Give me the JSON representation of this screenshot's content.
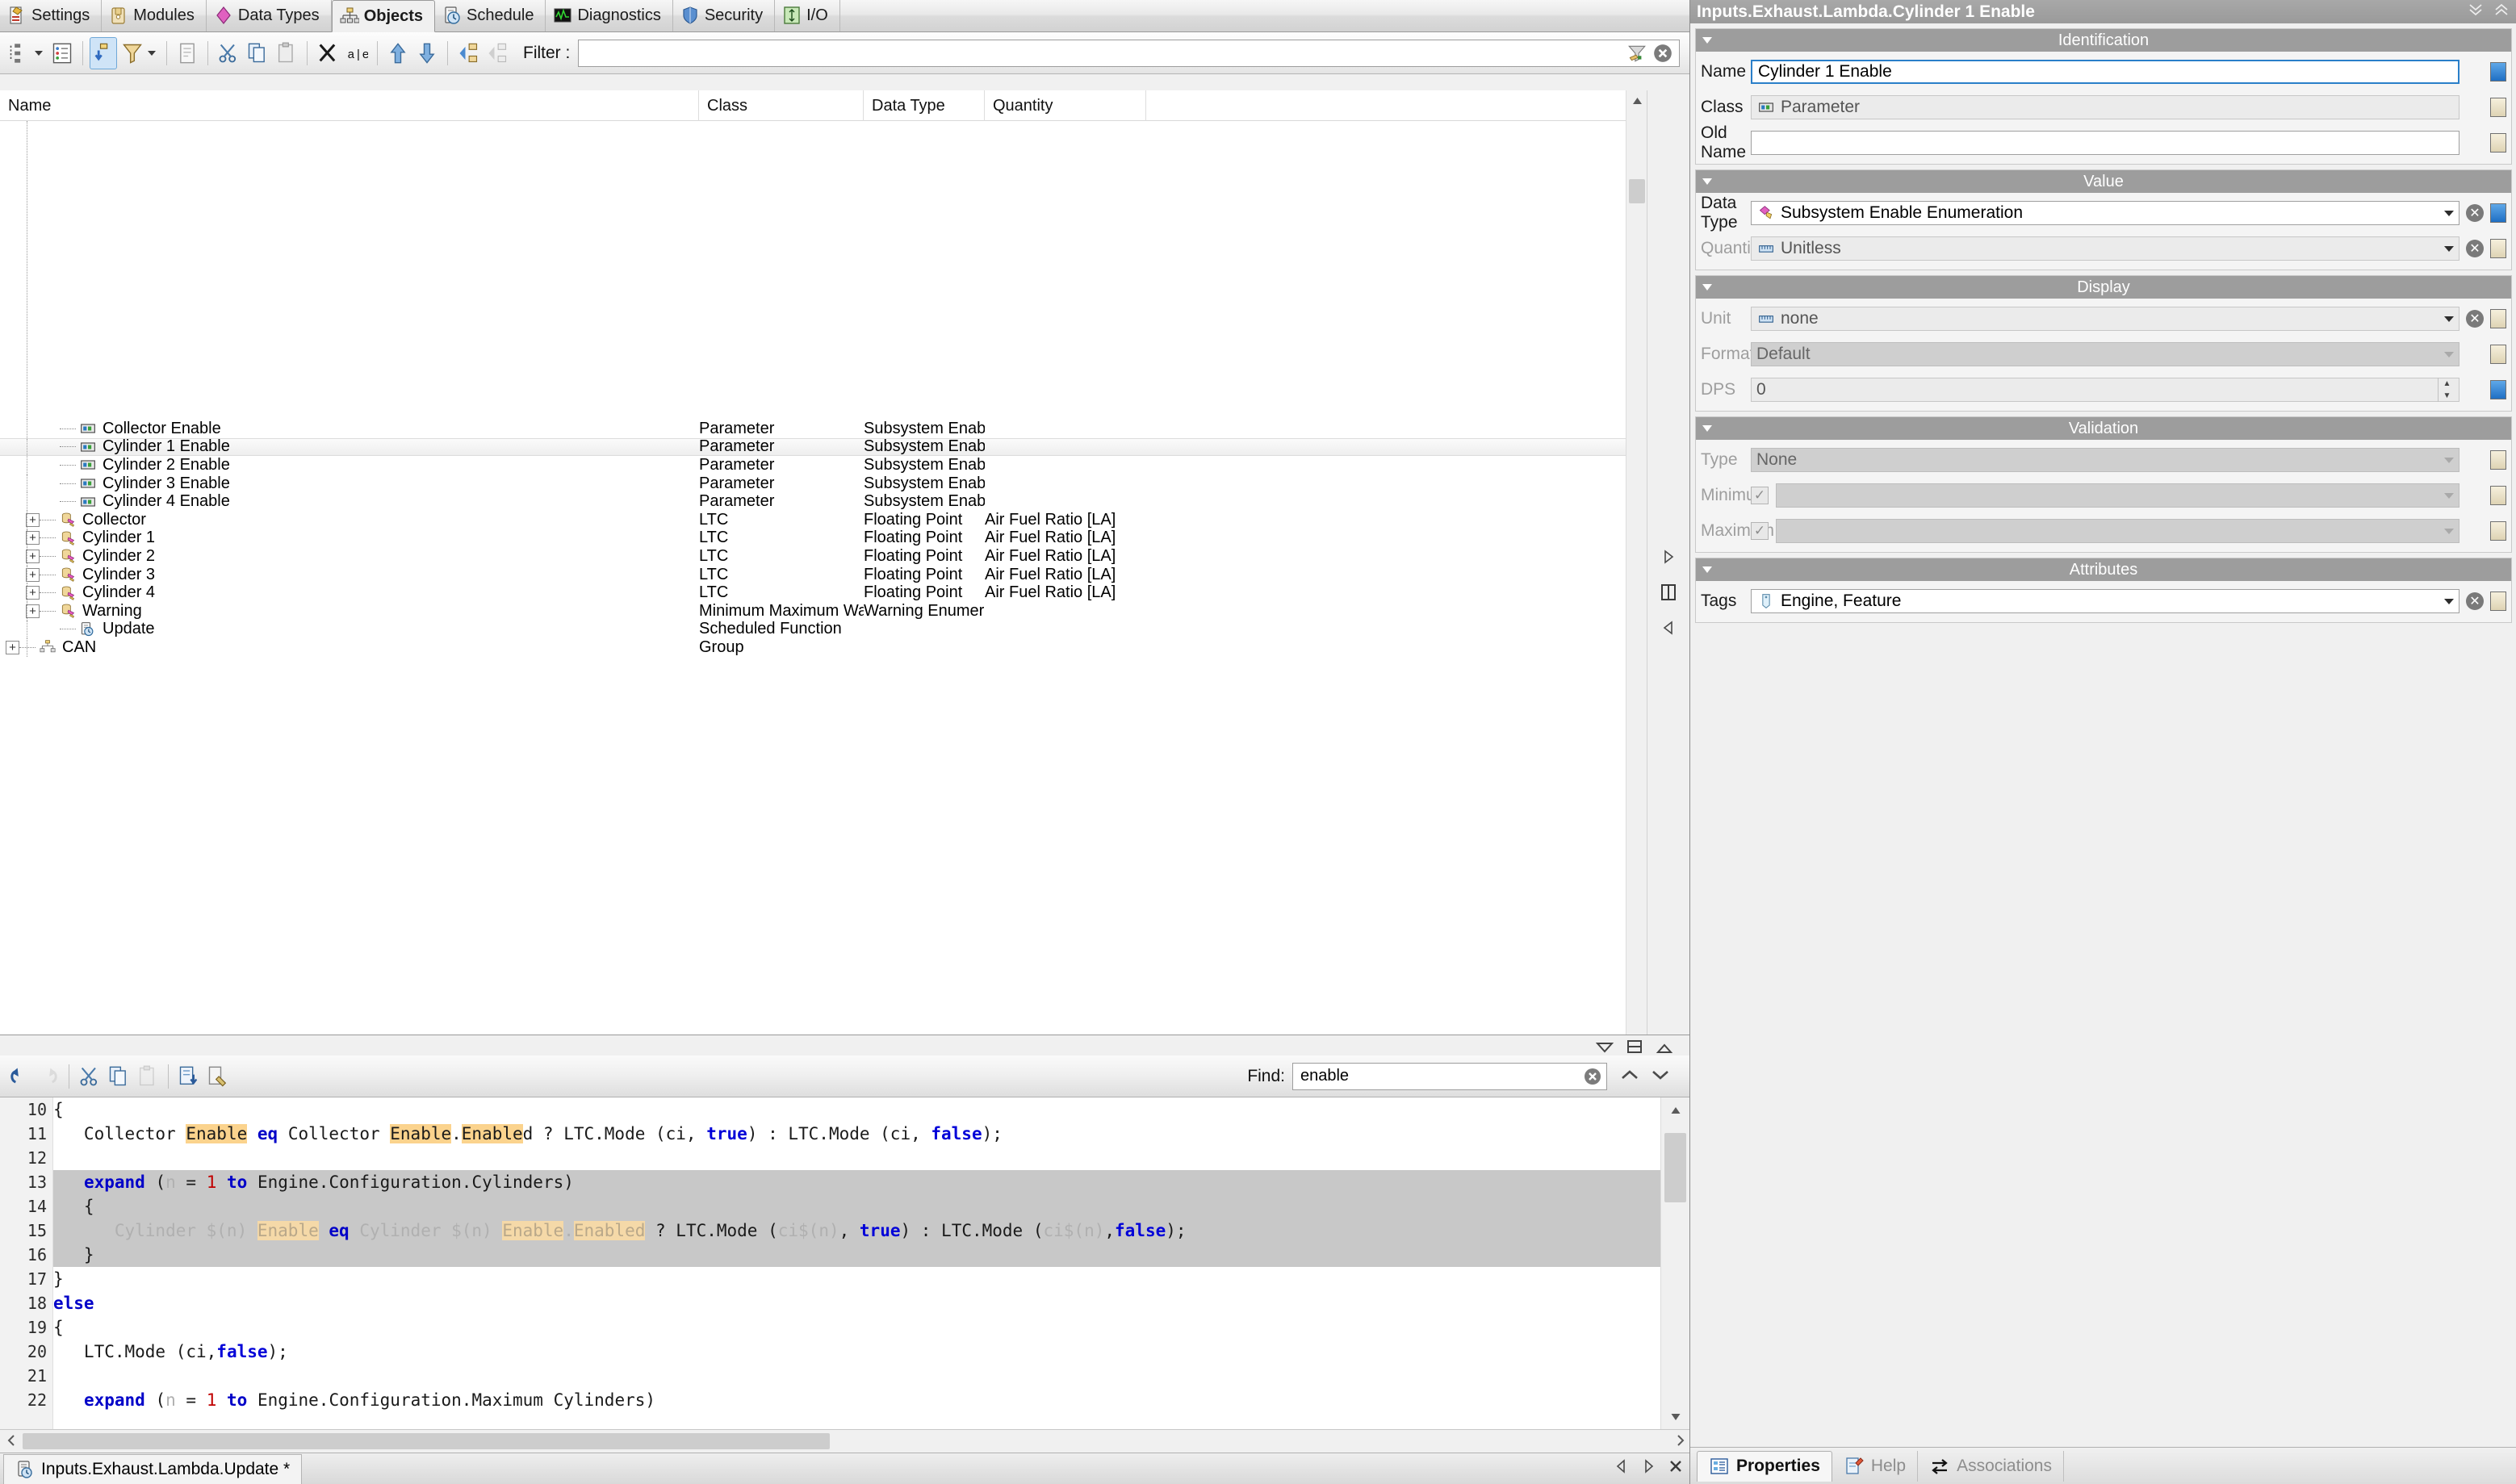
{
  "main_tabs": [
    {
      "label": "Settings",
      "icon": "settings-icon",
      "active": false
    },
    {
      "label": "Modules",
      "icon": "modules-icon",
      "active": false
    },
    {
      "label": "Data Types",
      "icon": "data-types-icon",
      "active": false
    },
    {
      "label": "Objects",
      "icon": "objects-icon",
      "active": true
    },
    {
      "label": "Schedule",
      "icon": "schedule-icon",
      "active": false
    },
    {
      "label": "Diagnostics",
      "icon": "diagnostics-icon",
      "active": false
    },
    {
      "label": "Security",
      "icon": "security-icon",
      "active": false
    },
    {
      "label": "I/O",
      "icon": "io-icon",
      "active": false
    }
  ],
  "object_toolbar": {
    "buttons": [
      {
        "name": "tree-view-button",
        "icon": "tree-icon",
        "pressed": false,
        "has_caret": true
      },
      {
        "name": "list-view-button",
        "icon": "list-icon",
        "pressed": false,
        "has_caret": false
      },
      {
        "name": "sync-selection-button",
        "icon": "sync-icon",
        "pressed": true,
        "has_caret": false
      },
      {
        "name": "filter-button",
        "icon": "funnel-icon",
        "pressed": false,
        "has_caret": true
      },
      {
        "name": "properties-button",
        "icon": "document-icon",
        "pressed": false,
        "has_caret": false
      },
      {
        "name": "cut-button",
        "icon": "scissors-icon",
        "pressed": false,
        "has_caret": false
      },
      {
        "name": "copy-button",
        "icon": "copy-icon",
        "pressed": false,
        "has_caret": false
      },
      {
        "name": "paste-button",
        "icon": "paste-icon",
        "pressed": false,
        "has_caret": false
      },
      {
        "name": "delete-button",
        "icon": "x-icon",
        "pressed": false,
        "has_caret": false
      },
      {
        "name": "rename-button",
        "icon": "rename-icon",
        "pressed": false,
        "has_caret": false
      },
      {
        "name": "move-up-button",
        "icon": "arrow-up-icon",
        "pressed": false,
        "has_caret": false
      },
      {
        "name": "move-down-button",
        "icon": "arrow-down-icon",
        "pressed": false,
        "has_caret": false
      },
      {
        "name": "expand-all-button",
        "icon": "expand-all-icon",
        "pressed": false,
        "has_caret": false
      },
      {
        "name": "collapse-all-button",
        "icon": "collapse-all-icon",
        "pressed": false,
        "has_caret": false
      }
    ],
    "filter_label": "Filter :",
    "filter_value": "",
    "filter_placeholder": "",
    "apply_filter_icon": "funnel-apply-icon",
    "clear_filter_icon": "clear-circle-icon"
  },
  "tree": {
    "columns": [
      "Name",
      "Class",
      "Data Type",
      "Quantity"
    ],
    "rows": [
      {
        "name": "Collector Enable",
        "indent": 2,
        "expander": "",
        "icon": "parameter-icon",
        "class": "Parameter",
        "dtype": "Subsystem Enable ...",
        "qty": "",
        "selected": false
      },
      {
        "name": "Cylinder 1 Enable",
        "indent": 2,
        "expander": "",
        "icon": "parameter-icon",
        "class": "Parameter",
        "dtype": "Subsystem Enable ...",
        "qty": "",
        "selected": true
      },
      {
        "name": "Cylinder 2 Enable",
        "indent": 2,
        "expander": "",
        "icon": "parameter-icon",
        "class": "Parameter",
        "dtype": "Subsystem Enable ...",
        "qty": "",
        "selected": false
      },
      {
        "name": "Cylinder 3 Enable",
        "indent": 2,
        "expander": "",
        "icon": "parameter-icon",
        "class": "Parameter",
        "dtype": "Subsystem Enable ...",
        "qty": "",
        "selected": false
      },
      {
        "name": "Cylinder 4 Enable",
        "indent": 2,
        "expander": "",
        "icon": "parameter-icon",
        "class": "Parameter",
        "dtype": "Subsystem Enable ...",
        "qty": "",
        "selected": false
      },
      {
        "name": "Collector",
        "indent": 1,
        "expander": "+",
        "icon": "ltc-icon",
        "class": "LTC",
        "dtype": "Floating Point",
        "qty": "Air Fuel Ratio [LA]",
        "selected": false
      },
      {
        "name": "Cylinder 1",
        "indent": 1,
        "expander": "+",
        "icon": "ltc-icon",
        "class": "LTC",
        "dtype": "Floating Point",
        "qty": "Air Fuel Ratio [LA]",
        "selected": false
      },
      {
        "name": "Cylinder 2",
        "indent": 1,
        "expander": "+",
        "icon": "ltc-icon",
        "class": "LTC",
        "dtype": "Floating Point",
        "qty": "Air Fuel Ratio [LA]",
        "selected": false
      },
      {
        "name": "Cylinder 3",
        "indent": 1,
        "expander": "+",
        "icon": "ltc-icon",
        "class": "LTC",
        "dtype": "Floating Point",
        "qty": "Air Fuel Ratio [LA]",
        "selected": false
      },
      {
        "name": "Cylinder 4",
        "indent": 1,
        "expander": "+",
        "icon": "ltc-icon",
        "class": "LTC",
        "dtype": "Floating Point",
        "qty": "Air Fuel Ratio [LA]",
        "selected": false
      },
      {
        "name": "Warning",
        "indent": 1,
        "expander": "+",
        "icon": "ltc-icon",
        "class": "Minimum Maximum Warning",
        "dtype": "Warning Enumeration",
        "qty": "",
        "selected": false
      },
      {
        "name": "Update",
        "indent": 2,
        "expander": "",
        "icon": "function-icon",
        "class": "Scheduled Function",
        "dtype": "",
        "qty": "",
        "selected": false
      },
      {
        "name": "CAN",
        "indent": 0,
        "expander": "+",
        "icon": "group-icon",
        "class": "Group",
        "dtype": "",
        "qty": "",
        "selected": false
      }
    ]
  },
  "editor_strip": {
    "icons": [
      "filter-down-icon",
      "split-horizontal-icon",
      "collapse-up-icon"
    ]
  },
  "code_toolbar": {
    "buttons": [
      {
        "name": "undo-button",
        "icon": "undo-icon",
        "disabled": false
      },
      {
        "name": "redo-button",
        "icon": "redo-icon",
        "disabled": true
      },
      {
        "name": "cut-button",
        "icon": "scissors-icon",
        "disabled": false
      },
      {
        "name": "copy-button",
        "icon": "copy-icon",
        "disabled": false
      },
      {
        "name": "paste-button",
        "icon": "paste-icon",
        "disabled": true
      },
      {
        "name": "insert-snippet-button",
        "icon": "insert-doc-icon",
        "disabled": false
      },
      {
        "name": "build-button",
        "icon": "build-doc-icon",
        "disabled": false
      }
    ],
    "find_label": "Find:",
    "find_value": "enable",
    "find_placeholder": "",
    "clear_find_icon": "clear-circle-icon",
    "find_prev_icon": "chevron-up-icon",
    "find_next_icon": "chevron-down-icon"
  },
  "code": {
    "first_line": 10,
    "lines": [
      {
        "n": 10,
        "selected": false,
        "tokens": [
          {
            "t": "{"
          }
        ]
      },
      {
        "n": 11,
        "selected": false,
        "tokens": [
          {
            "t": "   Collector "
          },
          {
            "t": "Enable",
            "s": "hl"
          },
          {
            "t": " "
          },
          {
            "t": "eq",
            "s": "kw"
          },
          {
            "t": " Collector "
          },
          {
            "t": "Enable",
            "s": "hl"
          },
          {
            "t": "."
          },
          {
            "t": "Enable",
            "s": "hl"
          },
          {
            "t": "d ? LTC.Mode (ci, "
          },
          {
            "t": "true",
            "s": "lit"
          },
          {
            "t": ") : LTC.Mode (ci, "
          },
          {
            "t": "false",
            "s": "lit"
          },
          {
            "t": ");"
          }
        ]
      },
      {
        "n": 12,
        "selected": false,
        "tokens": [
          {
            "t": ""
          }
        ]
      },
      {
        "n": 13,
        "selected": true,
        "tokens": [
          {
            "t": "   "
          },
          {
            "t": "expand",
            "s": "kw"
          },
          {
            "t": " ("
          },
          {
            "t": "n",
            "s": "dim"
          },
          {
            "t": " = "
          },
          {
            "t": "1",
            "s": "num"
          },
          {
            "t": " "
          },
          {
            "t": "to",
            "s": "kw"
          },
          {
            "t": " Engine.Configuration.Cylinders)"
          }
        ]
      },
      {
        "n": 14,
        "selected": true,
        "tokens": [
          {
            "t": "   {"
          }
        ]
      },
      {
        "n": 15,
        "selected": true,
        "tokens": [
          {
            "t": "      Cylinder $(n) ",
            "s": "dim"
          },
          {
            "t": "Enable",
            "s": "dimhl"
          },
          {
            "t": " ",
            "s": "dim"
          },
          {
            "t": "eq",
            "s": "kw"
          },
          {
            "t": " Cylinder $(n) ",
            "s": "dim"
          },
          {
            "t": "Enable",
            "s": "dimhl"
          },
          {
            "t": ".",
            "s": "dim"
          },
          {
            "t": "Enabled",
            "s": "dimhl"
          },
          {
            "t": " ? LTC.Mode ("
          },
          {
            "t": "ci$(n)",
            "s": "dim"
          },
          {
            "t": ", "
          },
          {
            "t": "true",
            "s": "lit"
          },
          {
            "t": ") : LTC.Mode ("
          },
          {
            "t": "ci$(n)",
            "s": "dim"
          },
          {
            "t": ","
          },
          {
            "t": "false",
            "s": "lit"
          },
          {
            "t": ");"
          }
        ]
      },
      {
        "n": 16,
        "selected": true,
        "tokens": [
          {
            "t": "   }"
          }
        ]
      },
      {
        "n": 17,
        "selected": false,
        "tokens": [
          {
            "t": "}"
          }
        ]
      },
      {
        "n": 18,
        "selected": false,
        "tokens": [
          {
            "t": "else",
            "s": "kw"
          }
        ]
      },
      {
        "n": 19,
        "selected": false,
        "tokens": [
          {
            "t": "{"
          }
        ]
      },
      {
        "n": 20,
        "selected": false,
        "tokens": [
          {
            "t": "   LTC.Mode (ci,"
          },
          {
            "t": "false",
            "s": "lit"
          },
          {
            "t": ");"
          }
        ]
      },
      {
        "n": 21,
        "selected": false,
        "tokens": [
          {
            "t": ""
          }
        ]
      },
      {
        "n": 22,
        "selected": false,
        "tokens": [
          {
            "t": "   "
          },
          {
            "t": "expand",
            "s": "kw"
          },
          {
            "t": " ("
          },
          {
            "t": "n",
            "s": "dim"
          },
          {
            "t": " = "
          },
          {
            "t": "1",
            "s": "num"
          },
          {
            "t": " "
          },
          {
            "t": "to",
            "s": "kw"
          },
          {
            "t": " Engine.Configuration.Maximum Cylinders)"
          }
        ]
      }
    ]
  },
  "doc_tabs": {
    "tabs": [
      {
        "label": "Inputs.Exhaust.Lambda.Update *",
        "icon": "function-icon",
        "active": true
      }
    ],
    "nav_prev_icon": "nav-prev-icon",
    "nav_next_icon": "nav-next-icon",
    "close_icon": "close-icon"
  },
  "properties": {
    "title": "Inputs.Exhaust.Lambda.Cylinder 1 Enable",
    "title_expand_icon": "chevrons-down-icon",
    "title_collapse_icon": "chevrons-up-icon",
    "groups": [
      {
        "name": "Identification",
        "fields": [
          {
            "label": "Name",
            "value": "Cylinder 1 Enable",
            "state": "focus",
            "kind": "text",
            "icon": "",
            "caret": false,
            "clear": false,
            "swatch": "blue"
          },
          {
            "label": "Class",
            "value": "Parameter",
            "state": "readonly",
            "kind": "text",
            "icon": "parameter-icon",
            "caret": false,
            "clear": false,
            "swatch": "tan"
          },
          {
            "label": "Old Name",
            "value": "",
            "state": "normal",
            "kind": "text",
            "icon": "",
            "caret": false,
            "clear": false,
            "swatch": "tan"
          }
        ]
      },
      {
        "name": "Value",
        "fields": [
          {
            "label": "Data Type",
            "value": "Subsystem Enable Enumeration",
            "state": "normal",
            "kind": "combo",
            "icon": "enum-icon",
            "caret": true,
            "clear": true,
            "swatch": "blue"
          },
          {
            "label": "Quantity",
            "value": "Unitless",
            "state": "readonly",
            "kind": "combo",
            "icon": "ruler-icon",
            "caret": true,
            "clear": true,
            "swatch": "tan",
            "dim_label": true
          }
        ]
      },
      {
        "name": "Display",
        "fields": [
          {
            "label": "Unit",
            "value": "none",
            "state": "readonly",
            "kind": "combo",
            "icon": "ruler-icon",
            "caret": true,
            "clear": true,
            "swatch": "tan",
            "dim_label": true
          },
          {
            "label": "Format",
            "value": "Default",
            "state": "disabled",
            "kind": "combo",
            "icon": "",
            "caret": true,
            "caret_dis": true,
            "clear": false,
            "swatch": "tan",
            "dim_label": true
          },
          {
            "label": "DPS",
            "value": "0",
            "state": "readonly",
            "kind": "spin",
            "icon": "",
            "caret": false,
            "clear": false,
            "swatch": "blue",
            "dim_label": true
          }
        ]
      },
      {
        "name": "Validation",
        "fields": [
          {
            "label": "Type",
            "value": "None",
            "state": "disabled",
            "kind": "combo",
            "icon": "",
            "caret": true,
            "caret_dis": true,
            "clear": false,
            "swatch": "tan",
            "dim_label": true
          },
          {
            "label": "Minimum",
            "value": "",
            "state": "disabled",
            "kind": "combo",
            "icon": "",
            "caret": true,
            "caret_dis": true,
            "clear": false,
            "swatch": "tan",
            "dim_label": true,
            "checkbox": true,
            "checked": true
          },
          {
            "label": "Maximum",
            "value": "",
            "state": "disabled",
            "kind": "combo",
            "icon": "",
            "caret": true,
            "caret_dis": true,
            "clear": false,
            "swatch": "tan",
            "dim_label": true,
            "checkbox": true,
            "checked": true
          }
        ]
      },
      {
        "name": "Attributes",
        "fields": [
          {
            "label": "Tags",
            "value": "Engine, Feature",
            "state": "normal",
            "kind": "combo",
            "icon": "tag-icon",
            "caret": true,
            "clear": true,
            "swatch": "tan"
          }
        ]
      }
    ],
    "tabs": [
      {
        "label": "Properties",
        "icon": "properties-icon",
        "active": true
      },
      {
        "label": "Help",
        "icon": "help-pencil-icon",
        "active": false
      },
      {
        "label": "Associations",
        "icon": "associations-icon",
        "active": false
      }
    ]
  }
}
